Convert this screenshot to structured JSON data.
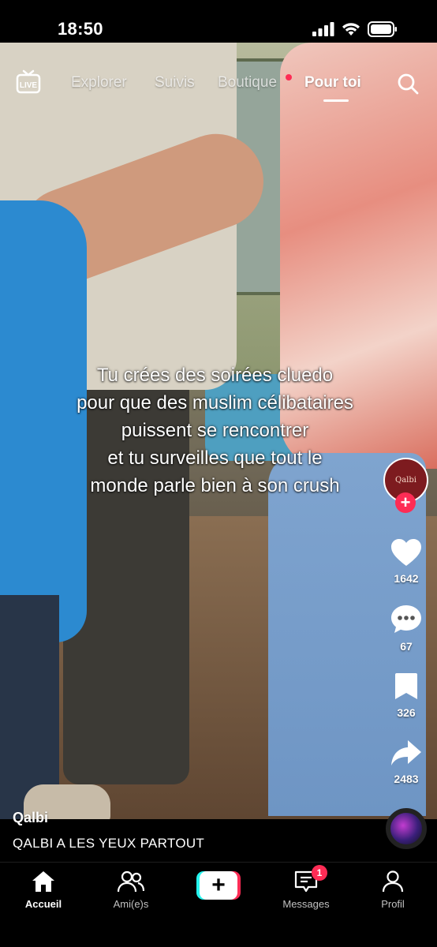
{
  "status_bar": {
    "time": "18:50"
  },
  "top_nav": {
    "tabs": [
      {
        "label": "Explorer",
        "active": false
      },
      {
        "label": "Suivis",
        "active": false
      },
      {
        "label": "Boutique",
        "active": false
      },
      {
        "label": "Pour toi",
        "active": true
      }
    ],
    "live_icon_label": "LIVE"
  },
  "video": {
    "caption_lines": [
      "Tu crées des soirées cluedo",
      "pour que des muslim célibataires",
      "puissent se rencontrer",
      "et tu surveilles que tout le",
      "monde parle bien à son crush"
    ]
  },
  "right_rail": {
    "avatar_text": "Qalbi",
    "likes": "1642",
    "comments": "67",
    "saves": "326",
    "shares": "2483"
  },
  "post": {
    "username": "Qalbi",
    "description": "QALBI A LES YEUX PARTOUT"
  },
  "tab_bar": {
    "items": [
      {
        "label": "Accueil",
        "active": true
      },
      {
        "label": "Ami(e)s",
        "active": false
      },
      {
        "label": "Messages",
        "active": false,
        "badge": "1"
      },
      {
        "label": "Profil",
        "active": false
      }
    ]
  },
  "colors": {
    "accent": "#fe2c55",
    "cyan": "#25f4ee",
    "background": "#000000"
  }
}
